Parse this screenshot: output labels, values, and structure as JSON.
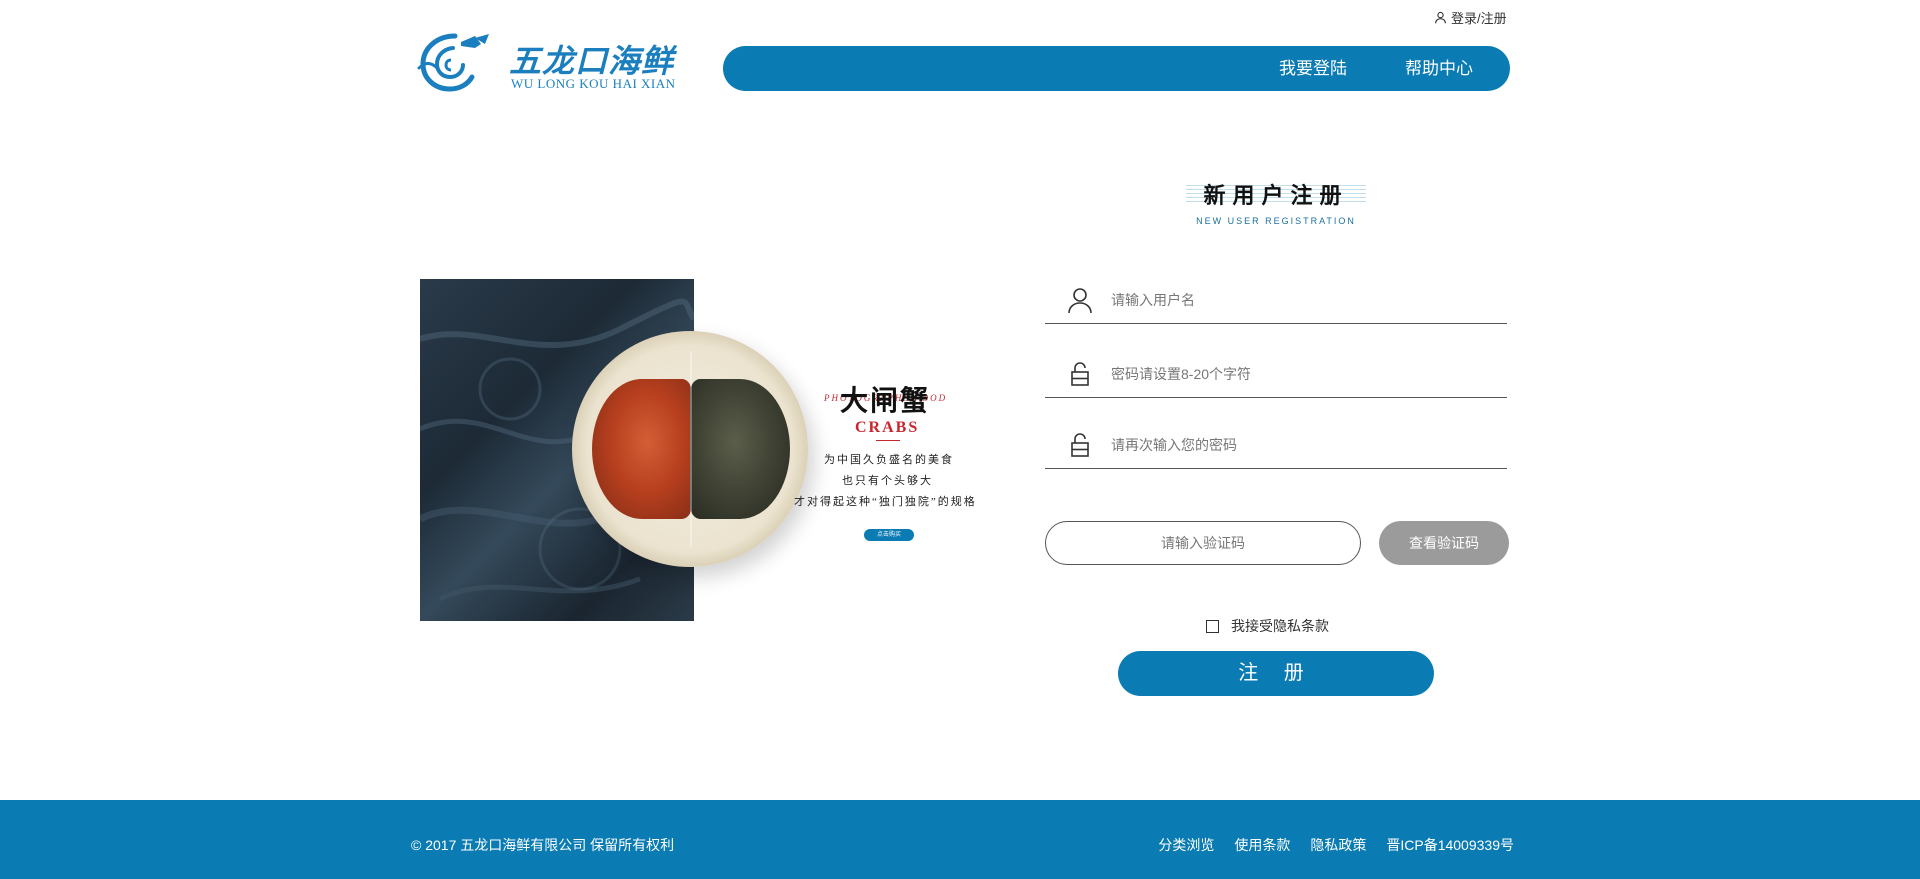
{
  "header": {
    "login_register": "登录/注册",
    "logo": {
      "cn": "五龙口海鲜",
      "en": "WU LONG KOU HAI XIAN"
    },
    "nav": [
      {
        "label": "我要登陆"
      },
      {
        "label": "帮助中心"
      }
    ]
  },
  "banner": {
    "sub_en": "PHOTOGRAPHS FOOD",
    "title_cn": "大闸蟹",
    "title_en": "CRABS",
    "lines": [
      "为中国久负盛名的美食",
      "也只有个头够大",
      "才对得起这种“独门独院”的规格"
    ],
    "button": "点击购买"
  },
  "form": {
    "title_cn": "新用户注册",
    "title_en": "NEW USER REGISTRATION",
    "username_placeholder": "请输入用户名",
    "password_placeholder": "密码请设置8-20个字符",
    "confirm_placeholder": "请再次输入您的密码",
    "captcha_placeholder": "请输入验证码",
    "captcha_button": "查看验证码",
    "agree_label": "我接受隐私条款",
    "submit": "注 册"
  },
  "footer": {
    "copyright": "© 2017 五龙口海鲜有限公司  保留所有权利",
    "links": [
      "分类浏览",
      "使用条款",
      "隐私政策",
      "晋ICP备14009339号"
    ]
  },
  "colors": {
    "primary": "#0a7bb3",
    "disabled_button": "#9b9b9b",
    "accent_red": "#c8262e"
  }
}
